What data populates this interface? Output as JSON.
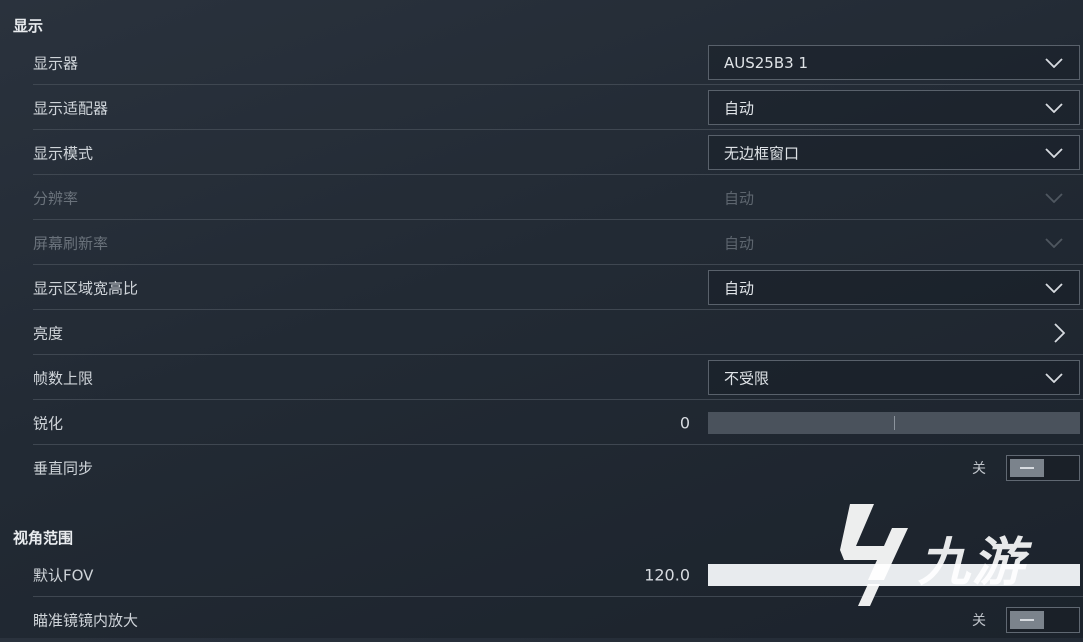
{
  "sections": {
    "display": "显示",
    "fov": "视角范围"
  },
  "rows": {
    "monitor": {
      "label": "显示器",
      "value": "AUS25B3 1"
    },
    "adapter": {
      "label": "显示适配器",
      "value": "自动"
    },
    "display_mode": {
      "label": "显示模式",
      "value": "无边框窗口"
    },
    "resolution": {
      "label": "分辨率",
      "value": "自动"
    },
    "refresh_rate": {
      "label": "屏幕刷新率",
      "value": "自动"
    },
    "aspect_ratio": {
      "label": "显示区域宽高比",
      "value": "自动"
    },
    "brightness": {
      "label": "亮度"
    },
    "fps_limit": {
      "label": "帧数上限",
      "value": "不受限"
    },
    "sharpen": {
      "label": "锐化",
      "value": "0",
      "level": 0.0
    },
    "vsync": {
      "label": "垂直同步",
      "state": "关"
    },
    "default_fov": {
      "label": "默认FOV",
      "value": "120.0",
      "level": 1.0
    },
    "scope_zoom": {
      "label": "瞄准镜镜内放大",
      "state": "关"
    }
  },
  "watermark": {
    "text": "九游"
  },
  "icons": {
    "dropdown": "chevron-down-icon",
    "submenu": "chevron-right-icon",
    "watermark": "jiuyou-logo-icon"
  }
}
